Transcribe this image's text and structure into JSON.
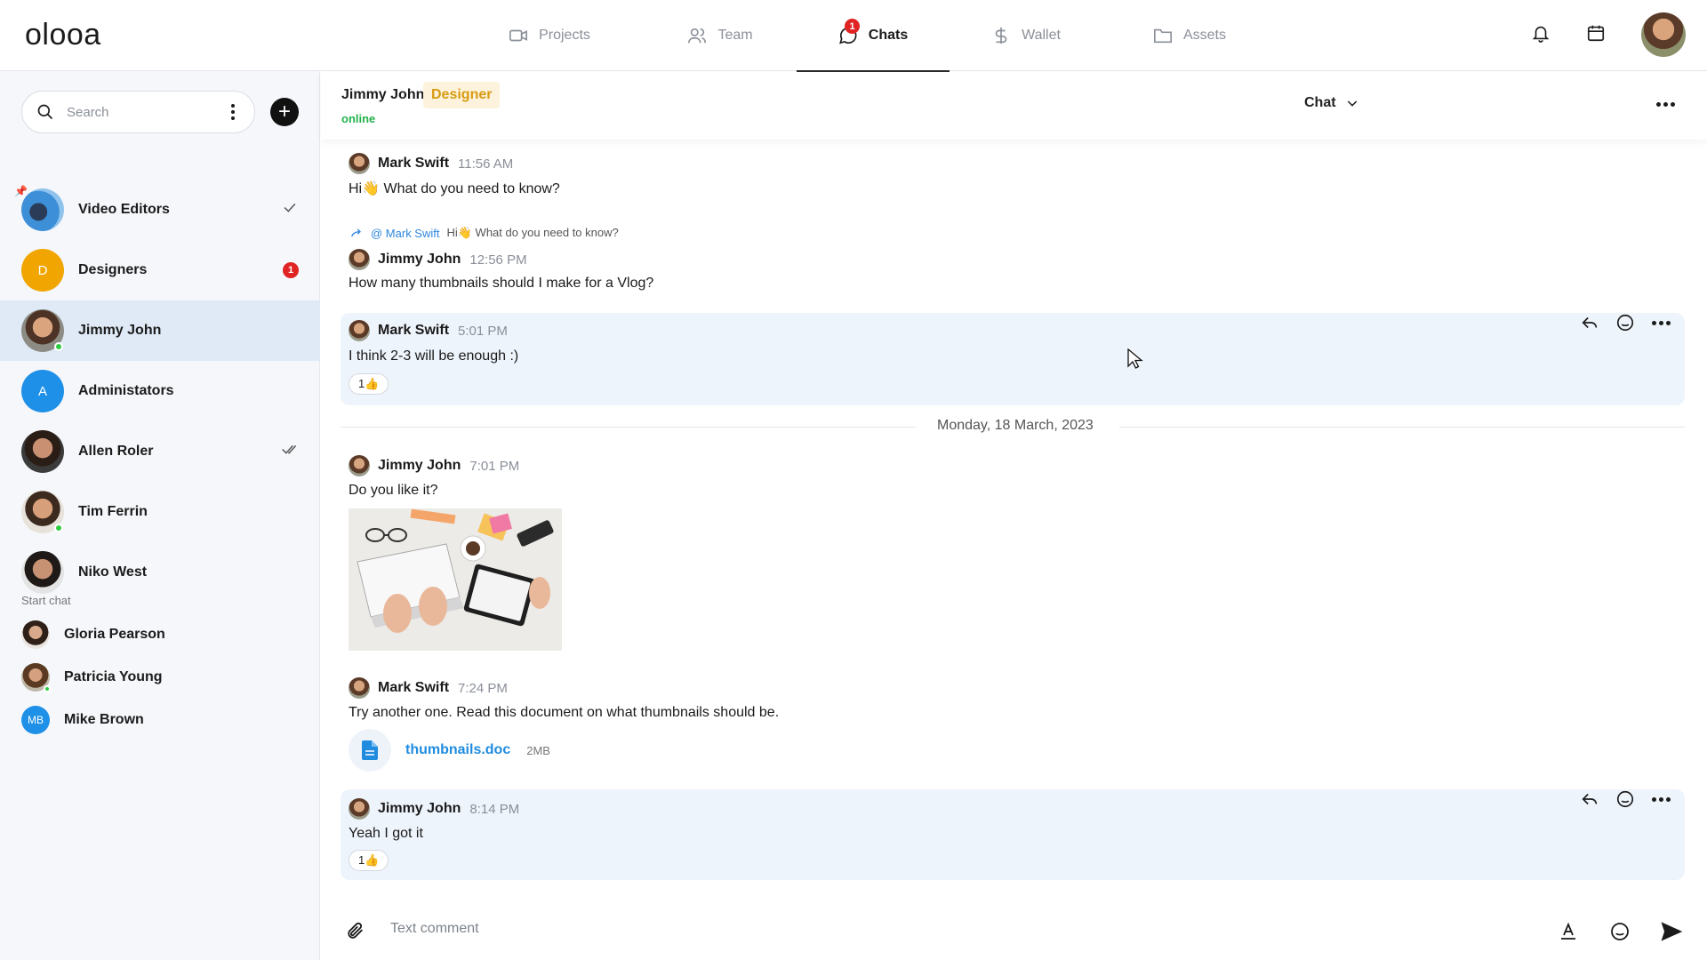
{
  "app": {
    "logo": "olooa"
  },
  "nav": {
    "tabs": [
      {
        "label": "Projects",
        "icon": "video-camera-icon"
      },
      {
        "label": "Team",
        "icon": "users-icon"
      },
      {
        "label": "Chats",
        "icon": "chat-bubble-icon",
        "badge": "1",
        "active": true
      },
      {
        "label": "Wallet",
        "icon": "dollar-icon"
      },
      {
        "label": "Assets",
        "icon": "folder-icon"
      }
    ],
    "right_icons": [
      "bell-icon",
      "calendar-icon",
      "user-avatar"
    ]
  },
  "sidebar": {
    "search_placeholder": "Search",
    "add_label": "+",
    "chats": [
      {
        "name": "Video Editors",
        "status": "read-check"
      },
      {
        "name": "Designers",
        "initial": "D",
        "unread": "1",
        "color": "#f0a500"
      },
      {
        "name": "Jimmy John",
        "active": true,
        "online": true
      },
      {
        "name": "Administators",
        "initial": "A",
        "color": "#1e90e8"
      },
      {
        "name": "Allen Roler",
        "status": "double-check"
      },
      {
        "name": "Tim Ferrin",
        "online": true
      },
      {
        "name": "Niko West"
      }
    ],
    "start_chat_label": "Start chat",
    "start_chats": [
      {
        "name": "Gloria Pearson"
      },
      {
        "name": "Patricia Young",
        "online": true
      },
      {
        "name": "Mike Brown",
        "initial": "MB",
        "color": "#1e90e8"
      }
    ]
  },
  "chat_header": {
    "name": "Jimmy John",
    "role": "Designer",
    "status": "online",
    "mode": "Chat"
  },
  "messages": [
    {
      "author": "Mark Swift",
      "time": "11:56 AM",
      "text": "Hi👋 What do you need to know?"
    },
    {
      "reply_to_author": "@ Mark Swift",
      "reply_to_text": "Hi👋 What do you need to know?",
      "author": "Jimmy John",
      "time": "12:56 PM",
      "text": "How many thumbnails should I make for a Vlog?"
    },
    {
      "author": "Mark Swift",
      "time": "5:01 PM",
      "text": "I think 2-3 will be enough :)",
      "reaction": "1👍"
    },
    {
      "author": "Jimmy John",
      "time": "7:01 PM",
      "text": "Do you like it?"
    },
    {
      "author": "Mark Swift",
      "time": "7:24 PM",
      "text": "Try another one. Read this document on what thumbnails should be.",
      "file_name": "thumbnails.doc",
      "file_size": "2MB"
    },
    {
      "author": "Jimmy John",
      "time": "8:14 PM",
      "text": "Yeah I got it",
      "reaction": "1👍"
    }
  ],
  "date_divider": "Monday, 18 March, 2023",
  "composer": {
    "placeholder": "Text comment"
  },
  "colors": {
    "accent_blue": "#1f8ce0",
    "badge_red": "#e02424",
    "online_green": "#22b24c",
    "designer_tag": "#d89b12"
  }
}
